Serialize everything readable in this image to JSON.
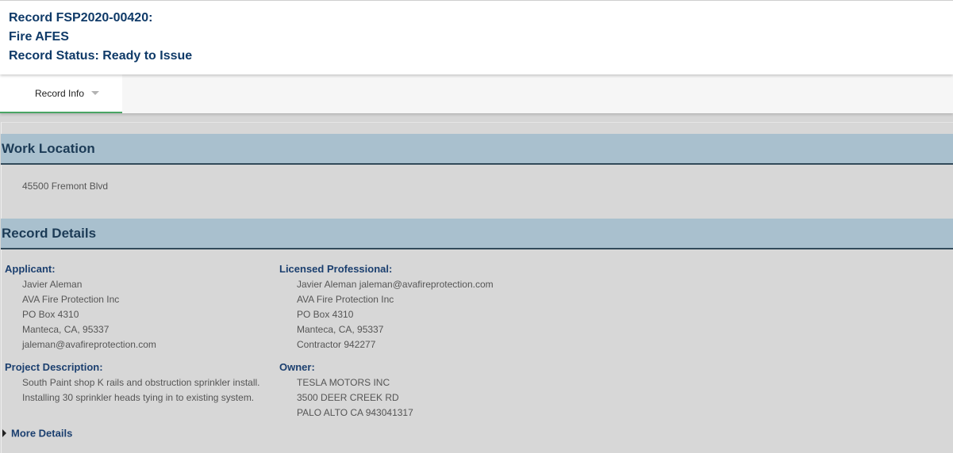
{
  "header": {
    "record_line": "Record FSP2020-00420:",
    "type_line": "Fire AFES",
    "status_line": "Record Status: Ready to Issue"
  },
  "tabs": [
    {
      "label": "Record Info",
      "active": true
    }
  ],
  "work_location": {
    "title": "Work Location",
    "address": "45500 Fremont Blvd"
  },
  "record_details": {
    "title": "Record Details",
    "applicant": {
      "label": "Applicant:",
      "lines": [
        "Javier Aleman",
        "AVA Fire Protection Inc",
        "PO Box 4310",
        "Manteca, CA, 95337",
        "jaleman@avafireprotection.com"
      ]
    },
    "licensed_professional": {
      "label": "Licensed Professional:",
      "lines": [
        "Javier Aleman jaleman@avafireprotection.com",
        "AVA Fire Protection Inc",
        "PO Box 4310",
        "Manteca, CA, 95337",
        "Contractor 942277"
      ]
    },
    "project_description": {
      "label": "Project Description:",
      "lines": [
        "South Paint shop K rails and obstruction sprinkler install.",
        "Installing 30 sprinkler heads tying in to existing system."
      ]
    },
    "owner": {
      "label": "Owner:",
      "lines": [
        "TESLA MOTORS INC",
        "3500 DEER CREEK RD",
        "PALO ALTO CA 943041317"
      ]
    },
    "more_details": "More Details"
  },
  "colors": {
    "header_text": "#0f3a68",
    "section_bar": "#a9c0ce",
    "section_border": "#324a5a",
    "active_tab_underline": "#4aa564",
    "label_text": "#1b3f6f"
  }
}
